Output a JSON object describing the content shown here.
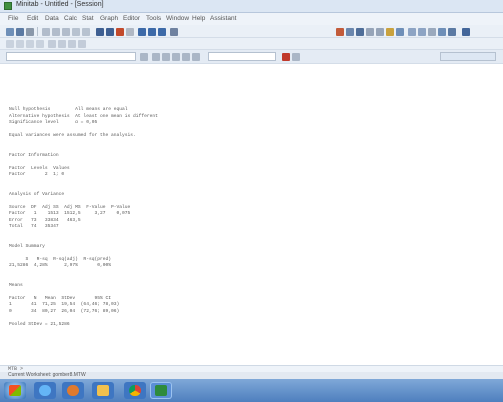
{
  "window": {
    "title": "Minitab - Untitled - [Session]"
  },
  "menu": [
    "File",
    "Edit",
    "Data",
    "Calc",
    "Stat",
    "Graph",
    "Editor",
    "Tools",
    "Window",
    "Help",
    "Assistant"
  ],
  "session": {
    "lines": [
      "Null hypothesis         All means are equal",
      "Alternative hypothesis  At least one mean is different",
      "Significance level      α = 0,05",
      "",
      "Equal variances were assumed for the analysis.",
      "",
      "",
      "Factor Information",
      "",
      "Factor  Levels  Values",
      "Factor       2  1; 0",
      "",
      "",
      "Analysis of Variance",
      "",
      "Source  DF  Adj SS  Adj MS  F-Value  P-Value",
      "Factor   1    1513  1512,5     3,27    0,075",
      "Error   73   33834   463,5",
      "Total   74   35347",
      "",
      "",
      "Model Summary",
      "",
      "      S   R-sq  R-sq(adj)  R-sq(pred)",
      "21,5286  4,28%      2,97%       0,00%",
      "",
      "",
      "Means",
      "",
      "Factor   N   Mean  StDev       95% CI",
      "1       41  71,25  19,54  (64,46; 78,03)",
      "0       34  80,27  26,04  (72,76; 89,06)",
      "",
      "Pooled StDev = 21,5286"
    ]
  },
  "command_line": {
    "prompt": "MTB >"
  },
  "status": {
    "text": "Current Worksheet: gomber8.MTW"
  }
}
